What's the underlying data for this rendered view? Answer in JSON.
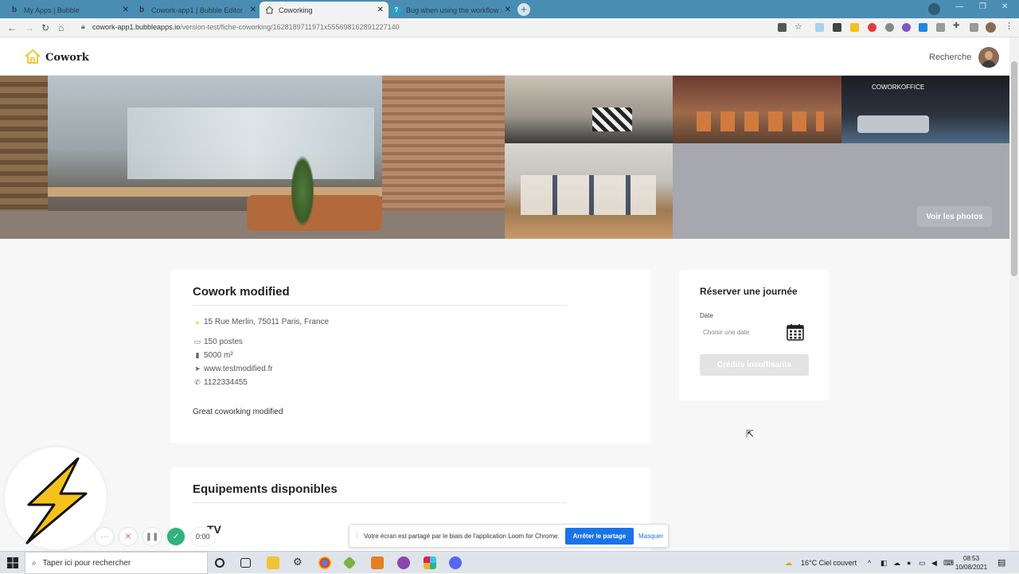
{
  "browser": {
    "tabs": [
      {
        "title": "My Apps | Bubble",
        "favicon": "b",
        "active": false
      },
      {
        "title": "Cowork-app1 | Bubble Editor",
        "favicon": "b",
        "active": false
      },
      {
        "title": "Coworking",
        "favicon": "home",
        "active": true
      },
      {
        "title": "Bug when using the workflow se",
        "favicon": "?",
        "active": false
      }
    ],
    "new_tab": "+",
    "close": "✕",
    "url_host": "cowork-app1.bubbleapps.io",
    "url_path": "/version-test/fiche-coworking/1628189711971x555698162891227140"
  },
  "header": {
    "brand": "Cowork",
    "search_link": "Recherche"
  },
  "gallery": {
    "see_photos": "Voir les photos",
    "sign_text": "COWORKOFFICE"
  },
  "coworking": {
    "name": "Cowork modified",
    "address": "15 Rue Merlin, 75011 Paris, France",
    "seats": "150 postes",
    "area": "5000 m²",
    "website": "www.testmodified.fr",
    "phone": "1122334455",
    "description": "Great coworking modified"
  },
  "equipment": {
    "title": "Equipements disponibles",
    "first_item_partial": "TV"
  },
  "booking": {
    "title": "Réserver une journée",
    "date_label": "Date",
    "date_placeholder": "Choisir une date",
    "button": "Crédits insuffisants"
  },
  "loom": {
    "timer": "0:00",
    "share_message": "Votre écran est partagé par le biais de l'application Loom for Chrome.",
    "stop_button": "Arrêter le partage",
    "hide_button": "Masquer"
  },
  "taskbar": {
    "search_placeholder": "Taper ici pour rechercher",
    "weather": "16°C  Ciel couvert",
    "time": "08:53",
    "date": "10/08/2021"
  },
  "colors": {
    "chrome_tabbar": "#4a8db3",
    "accent_blue": "#1a73e8",
    "loom_green": "#30b27c",
    "disabled_button": "#e3e3e3",
    "logo_yellow": "#f4c21b"
  }
}
